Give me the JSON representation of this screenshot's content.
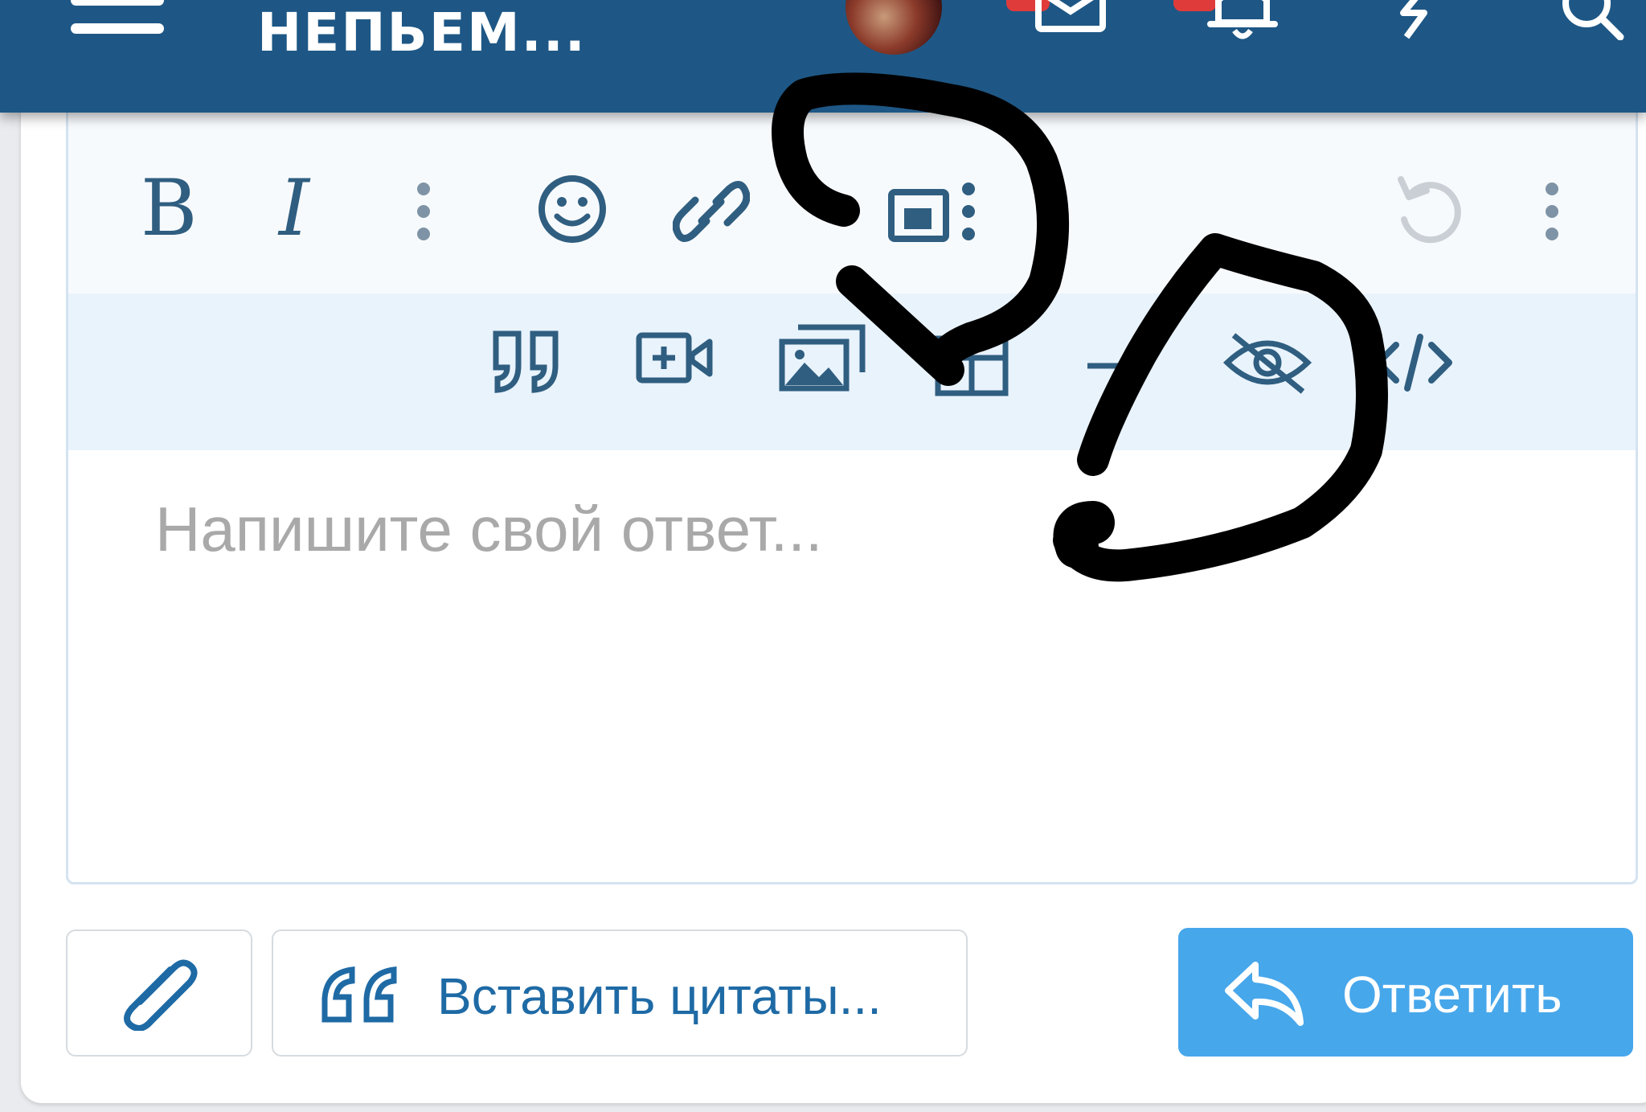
{
  "header": {
    "title": "НЕПЬЕМ...",
    "title_partial": "НЕПЬЕМ...",
    "icons": [
      "menu-icon",
      "avatar",
      "mail-icon",
      "bell-icon",
      "lightning-icon",
      "search-icon"
    ]
  },
  "editor": {
    "toolbar_row1": [
      "bold",
      "italic",
      "more-vertical",
      "smiley",
      "link",
      "image",
      "more-vertical",
      "undo",
      "more-vertical"
    ],
    "toolbar_row2": [
      "quote",
      "video-add",
      "media-gallery",
      "table",
      "minus",
      "hide-eye",
      "code"
    ],
    "bold_label": "B",
    "italic_label": "I",
    "placeholder": "Напишите свой ответ..."
  },
  "actions": {
    "insert_quotes_label": "Вставить цитаты...",
    "reply_label": "Ответить"
  },
  "colors": {
    "header_bg": "#1e5785",
    "toolbar_icon": "#2f5e80",
    "reply_button": "#47a7eb",
    "quotes_text": "#1e6aa5"
  }
}
